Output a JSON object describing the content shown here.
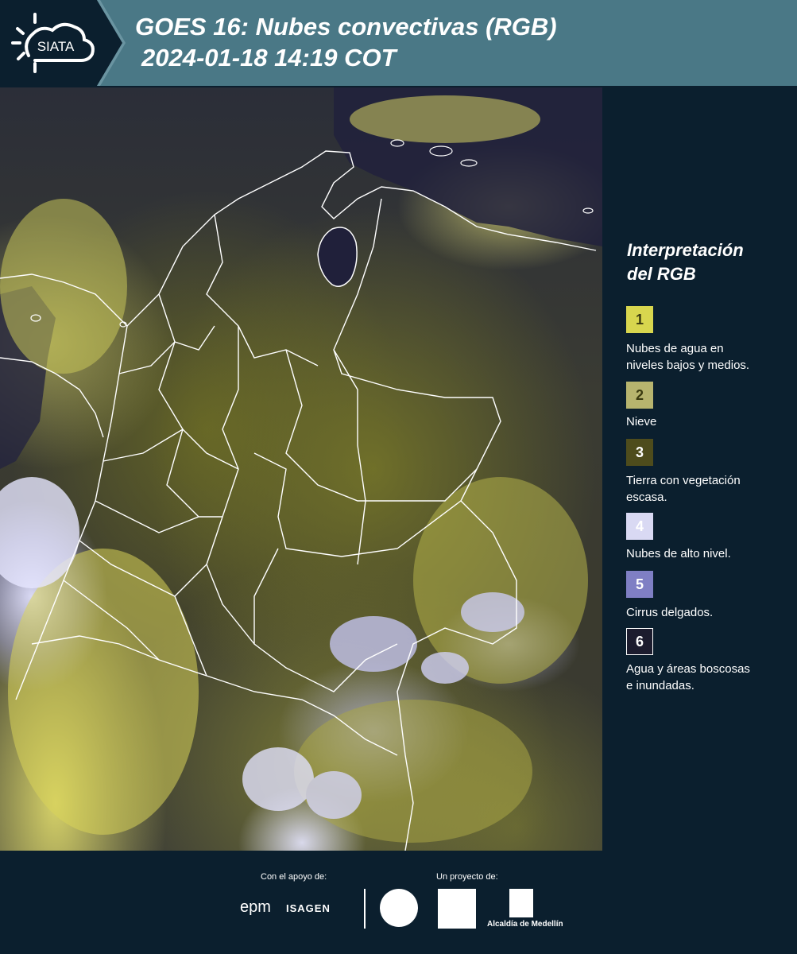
{
  "header": {
    "title_line1": "GOES 16: Nubes convectivas (RGB)",
    "title_line2": "2024-01-18 14:19 COT",
    "logo_text": "SIATA"
  },
  "legend": {
    "title_line1": "Interpretación",
    "title_line2": "del RGB",
    "items": [
      {
        "number": "1",
        "color": "#d8d64e",
        "text_color": "#3a3a10",
        "label_line1": "Nubes de agua en",
        "label_line2": "niveles bajos y medios."
      },
      {
        "number": "2",
        "color": "#b7b46e",
        "text_color": "#3a3a10",
        "label_line1": "Nieve",
        "label_line2": ""
      },
      {
        "number": "3",
        "color": "#4e4c1c",
        "text_color": "#ffffff",
        "label_line1": "Tierra con vegetación",
        "label_line2": "escasa."
      },
      {
        "number": "4",
        "color": "#d9d9f3",
        "text_color": "#ffffff",
        "label_line1": "Nubes de alto nivel.",
        "label_line2": ""
      },
      {
        "number": "5",
        "color": "#7f7fc4",
        "text_color": "#ffffff",
        "label_line1": "Cirrus delgados.",
        "label_line2": ""
      },
      {
        "number": "6",
        "color": "#1c1c2e",
        "text_color": "#ffffff",
        "label_line1": "Agua y áreas boscosas",
        "label_line2": "e inundadas."
      }
    ]
  },
  "footer": {
    "support_label": "Con el apoyo de:",
    "project_label": "Un proyecto de:",
    "epm_logo": "epm",
    "isagen_logo": "ISAGEN",
    "alcaldia_text": "Alcaldía de Medellín"
  }
}
